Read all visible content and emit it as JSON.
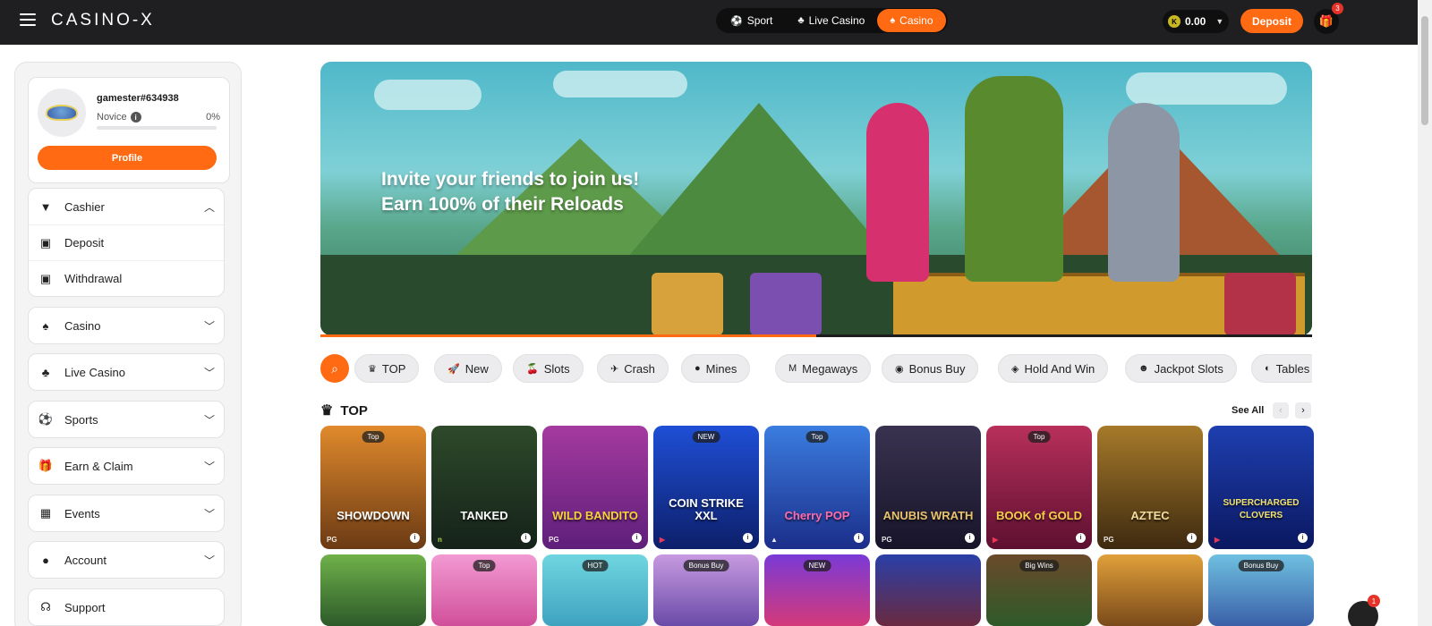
{
  "header": {
    "logo": "CASINO-X",
    "nav": [
      {
        "label": "Sport",
        "icon": "⚽"
      },
      {
        "label": "Live Casino",
        "icon": "♣"
      },
      {
        "label": "Casino",
        "icon": "♠"
      }
    ],
    "balance": "0.00",
    "coin": "K",
    "deposit_label": "Deposit",
    "gift_count": "3"
  },
  "user": {
    "name": "gamester#634938",
    "rank": "Novice",
    "progress": "0%",
    "profile_label": "Profile"
  },
  "sidebar": {
    "cashier": {
      "label": "Cashier",
      "items": [
        {
          "label": "Deposit"
        },
        {
          "label": "Withdrawal"
        }
      ]
    },
    "groups": [
      {
        "label": "Casino"
      },
      {
        "label": "Live Casino"
      },
      {
        "label": "Sports"
      },
      {
        "label": "Earn & Claim"
      },
      {
        "label": "Events"
      },
      {
        "label": "Account"
      },
      {
        "label": "Support"
      }
    ]
  },
  "banner": {
    "line1": "Invite your friends to join us!",
    "line2": "Earn 100% of their Reloads",
    "progress": 0.5
  },
  "filters": [
    {
      "label": "TOP",
      "icon": "♛"
    },
    {
      "label": "New",
      "icon": "🚀"
    },
    {
      "label": "Slots",
      "icon": "🍒"
    },
    {
      "label": "Crash",
      "icon": "✈"
    },
    {
      "label": "Mines",
      "icon": "●"
    },
    {
      "label": "Megaways",
      "icon": "M"
    },
    {
      "label": "Bonus Buy",
      "icon": "◉"
    },
    {
      "label": "Hold And Win",
      "icon": "◈"
    },
    {
      "label": "Jackpot Slots",
      "icon": "☻"
    },
    {
      "label": "Tables",
      "icon": "◐"
    }
  ],
  "section": {
    "title": "TOP",
    "see_all": "See All"
  },
  "games_row1": [
    {
      "name": "SHOWDOWN",
      "tag": "Top",
      "provider": "PG"
    },
    {
      "name": "TANKED",
      "tag": "",
      "provider": "n"
    },
    {
      "name": "WILD BANDITO",
      "tag": "",
      "provider": "PG"
    },
    {
      "name": "COIN STRIKE XXL",
      "tag": "NEW",
      "provider": "▶"
    },
    {
      "name": "Cherry POP",
      "tag": "Top",
      "provider": "▲"
    },
    {
      "name": "ANUBIS WRATH",
      "tag": "",
      "provider": "PG"
    },
    {
      "name": "BOOK of GOLD",
      "tag": "Top",
      "provider": "▶"
    },
    {
      "name": "AZTEC",
      "tag": "",
      "provider": "PG"
    },
    {
      "name": "SUPERCHARGED CLOVERS",
      "tag": "",
      "provider": "▶"
    }
  ],
  "games_row2": [
    {
      "tag": ""
    },
    {
      "tag": "Top"
    },
    {
      "tag": "HOT"
    },
    {
      "tag": "Bonus Buy"
    },
    {
      "tag": "NEW"
    },
    {
      "tag": ""
    },
    {
      "tag": "Big Wins"
    },
    {
      "tag": ""
    },
    {
      "tag": "Bonus Buy"
    }
  ],
  "chat_badge": "1",
  "colors": {
    "accent": "#ff6a13",
    "topbar": "#1f1f21"
  }
}
